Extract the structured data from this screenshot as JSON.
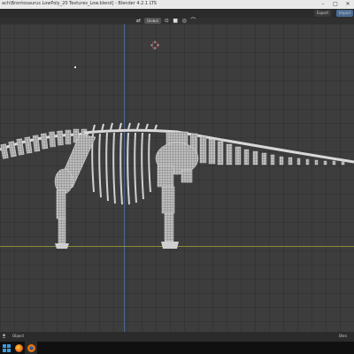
{
  "window": {
    "title": "ach\\Brontosaurus LowPoly_20 Textures_Low.blend] - Blender 4.2.1 LTS",
    "controls": [
      "–",
      "□",
      "✕"
    ]
  },
  "menu": {
    "import_label": "Import",
    "export_label": "Export"
  },
  "header": {
    "orientation": "Global"
  },
  "viewport": {
    "object_name": "Object"
  },
  "status": {
    "version": "Blen"
  },
  "icons": [
    "mouse-icon",
    "windows-icon",
    "firefox-icon",
    "blender-icon"
  ],
  "colors": {
    "grid_bg": "#3d3d3d",
    "mesh": "#d8d8d8",
    "axis_x": "#8a8a3a",
    "axis_y": "#4a6a9a"
  }
}
